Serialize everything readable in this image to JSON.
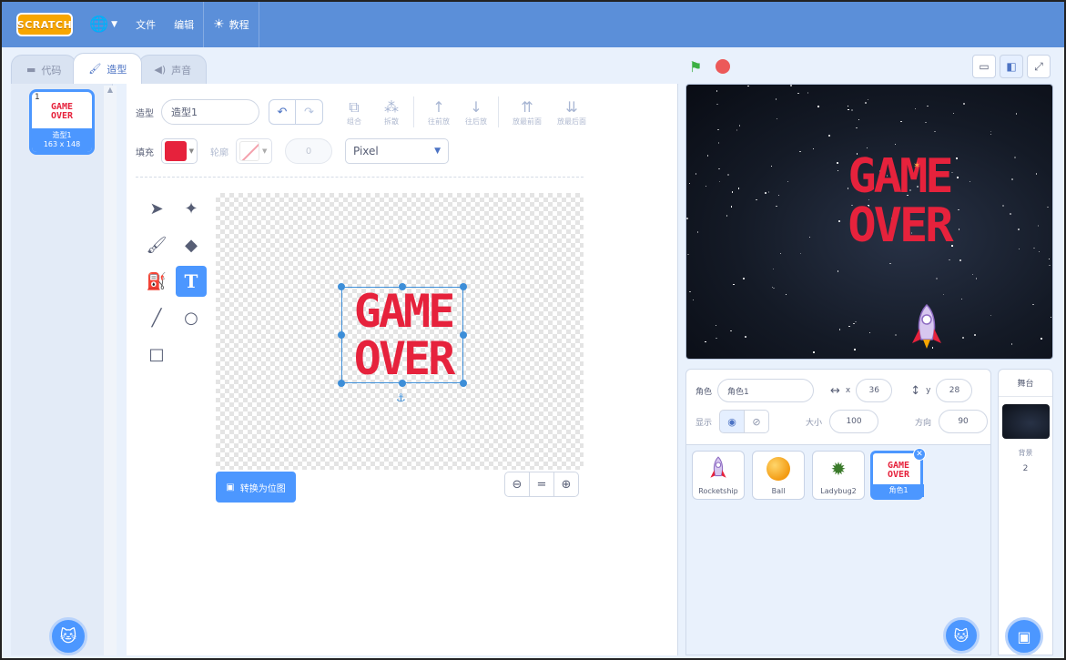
{
  "menu": {
    "logo": "SCRATCH",
    "file": "文件",
    "edit": "编辑",
    "tutorials": "教程"
  },
  "tabs": [
    {
      "label": "代码",
      "icon": "code-icon"
    },
    {
      "label": "造型",
      "icon": "brush-icon"
    },
    {
      "label": "声音",
      "icon": "sound-icon"
    }
  ],
  "costume_list": {
    "items": [
      {
        "number": "1",
        "thumb_line1": "GAME",
        "thumb_line2": "OVER",
        "name": "造型1",
        "size": "163 x 148"
      }
    ]
  },
  "editor": {
    "costume_label": "造型",
    "costume_name": "造型1",
    "group": "组合",
    "ungroup": "拆散",
    "forward": "往前放",
    "backward": "往后放",
    "front": "放最前面",
    "back": "放最后面",
    "fill_label": "填充",
    "outline_label": "轮廓",
    "outline_width": "0",
    "font": "Pixel",
    "fill_color": "#e6223c",
    "canvas_line1": "GAME",
    "canvas_line2": "OVER",
    "convert_bitmap": "转换为位图",
    "zoom_reset": "="
  },
  "stage": {
    "line1": "GAME",
    "line2": "OVER"
  },
  "sprite_info": {
    "sprite_label": "角色",
    "sprite_name": "角色1",
    "x_label": "x",
    "x": "36",
    "y_label": "y",
    "y": "28",
    "show_label": "显示",
    "size_label": "大小",
    "size": "100",
    "direction_label": "方向",
    "direction": "90"
  },
  "sprites": [
    {
      "name": "Rocketship"
    },
    {
      "name": "Ball"
    },
    {
      "name": "Ladybug2"
    },
    {
      "name": "角色1",
      "thumb_line1": "GAME",
      "thumb_line2": "OVER"
    }
  ],
  "stage_col": {
    "title": "舞台",
    "backdrop_label": "背景",
    "backdrop_count": "2"
  }
}
